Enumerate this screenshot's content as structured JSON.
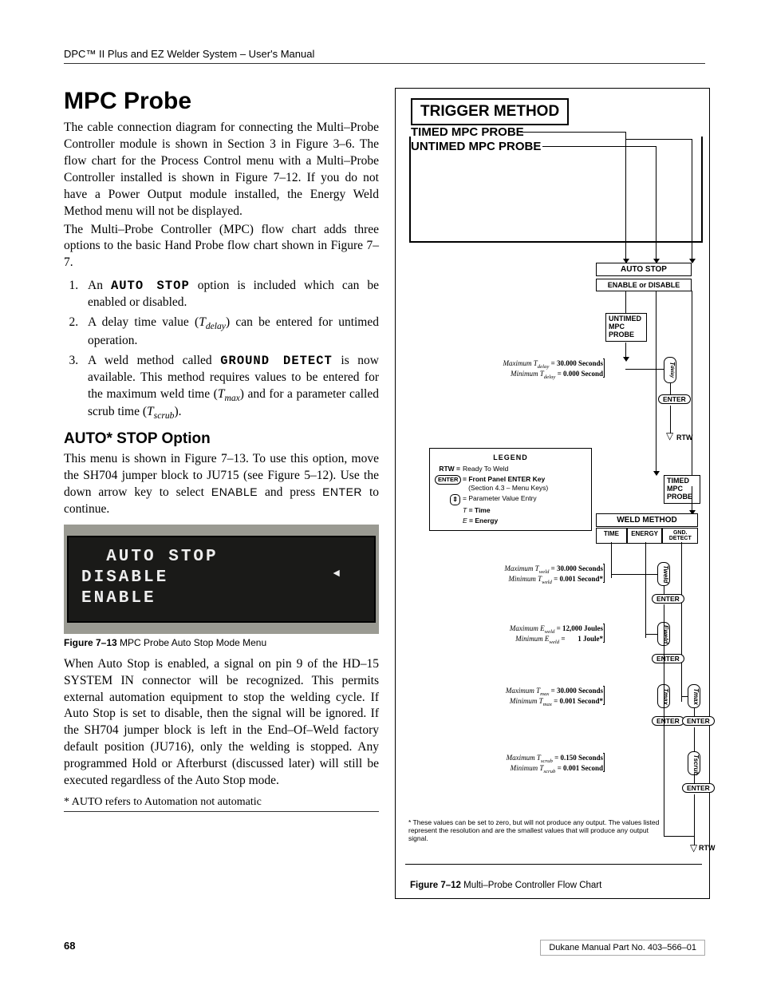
{
  "header": "DPC™ II Plus and EZ Welder System – User's Manual",
  "title": "MPC Probe",
  "para1": "The cable connection diagram for connecting the Multi–Probe Controller module is shown in Section 3 in Figure 3–6. The flow chart for the Process Control menu with a Multi–Probe Controller installed is shown in Figure 7–12. If you do not have a Power Output module installed, the Energy Weld Method menu will not be displayed.",
  "para2": "The Multi–Probe Controller (MPC) flow chart adds three options to the basic Hand Probe flow chart shown in Figure 7–7.",
  "list": {
    "i1a": "An ",
    "i1b": "AUTO STOP",
    "i1c": " option is included which can be enabled or disabled.",
    "i2a": "A delay time value (",
    "i2b": "T",
    "i2c": "delay",
    "i2d": ") can be entered for untimed operation.",
    "i3a": "A weld method called ",
    "i3b": "GROUND DETECT",
    "i3c": " is now available. This method requires values to be entered for the maximum weld time (",
    "i3d": "T",
    "i3e": "max",
    "i3f": ") and for a parameter called scrub time (",
    "i3g": "T",
    "i3h": "scrub",
    "i3i": ")."
  },
  "h2": "AUTO* STOP Option",
  "para3a": "This menu is shown in Figure 7–13. To use this option, move the SH704 jumper block to JU715 (see Figure 5–12). Use the down arrow key to select ",
  "para3b": "ENABLE",
  "para3c": " and press ",
  "para3d": "ENTER",
  "para3e": " to continue.",
  "screen": {
    "l1": "  AUTO STOP",
    "l2": "DISABLE",
    "l3": "ENABLE"
  },
  "fig13": {
    "bold": "Figure 7–13",
    "rest": "   MPC Probe Auto Stop Mode Menu"
  },
  "para4": "When Auto Stop is enabled, a signal on pin 9 of the HD–15 SYSTEM IN connector will be recognized. This permits external automation equipment to stop the welding cycle. If Auto Stop is set to disable, then the signal will be ignored. If the SH704 jumper block is left in the End–Of–Weld factory default position (JU716), only the welding is stopped. Any programmed Hold or Afterburst (discussed later) will still be executed regardless of the Auto Stop mode.",
  "footnote": "* AUTO refers to Automation not automatic",
  "page_num": "68",
  "part_no": "Dukane Manual Part No. 403–566–01",
  "flowchart": {
    "title": "TRIGGER  METHOD",
    "sub1": "TIMED MPC PROBE",
    "sub2": "UNTIMED MPC PROBE",
    "autostop": "AUTO  STOP",
    "enable_disable": "ENABLE or DISABLE",
    "untimed_box": "UNTIMED\nMPC\nPROBE",
    "timed_box": "TIMED\nMPC\nPROBE",
    "weld_method": "WELD METHOD",
    "wm_time": "TIME",
    "wm_energy": "ENERGY",
    "wm_gnd": "GND.\nDETECT",
    "enter": "ENTER",
    "rtw": "RTW",
    "scroll_tdelay": "Tdelay",
    "scroll_tweld": "Tweld",
    "scroll_eweld": "Eweld",
    "scroll_tmax": "Tmax",
    "scroll_tscrub": "Tscrub",
    "p_tdelay_max": "Maximum T",
    "p_tdelay_max_sub": "delay",
    "p_tdelay_max_val": " = 30.000 Seconds",
    "p_tdelay_min": "Minimum T",
    "p_tdelay_min_sub": "delay",
    "p_tdelay_min_val": " =  0.000 Second",
    "p_tweld_max": "Maximum T",
    "p_tweld_max_sub": "weld",
    "p_tweld_max_val": " = 30.000 Seconds",
    "p_tweld_min": "Minimum T",
    "p_tweld_min_sub": "weld",
    "p_tweld_min_val": " =  0.001 Second*",
    "p_eweld_max": "Maximum E",
    "p_eweld_max_sub": "weld",
    "p_eweld_max_val": " = 12,000 Joules",
    "p_eweld_min": "Minimum E",
    "p_eweld_min_sub": "weld",
    "p_eweld_min_val": " =       1 Joule*",
    "p_tmax_max": "Maximum T",
    "p_tmax_max_sub": "max",
    "p_tmax_max_val": " = 30.000 Seconds",
    "p_tmax_min": "Minimum T",
    "p_tmax_min_sub": "max",
    "p_tmax_min_val": " =  0.001 Second*",
    "p_tscrub_max": "Maximum T",
    "p_tscrub_max_sub": "scrub",
    "p_tscrub_max_val": " = 0.150 Seconds",
    "p_tscrub_min": "Minimum T",
    "p_tscrub_min_sub": "scrub",
    "p_tscrub_min_val": " = 0.001 Second",
    "legend_title": "LEGEND",
    "lg_rtw": "RTW = ",
    "lg_rtw_v": "Ready To Weld",
    "lg_enter": "ENTER",
    "lg_enter_v": "= Front Panel ENTER Key\n(Section 4.3 – Menu Keys)",
    "lg_scroll_v": "= Parameter Value Entry",
    "lg_t": "T = Time",
    "lg_e": "E = Energy",
    "star_note": "* These values can be set to zero, but will not produce any output. The values listed represent the resolution and are the smallest values that will produce any output signal.",
    "fig12_bold": "Figure 7–12",
    "fig12_rest": "   Multi–Probe Controller Flow Chart"
  }
}
